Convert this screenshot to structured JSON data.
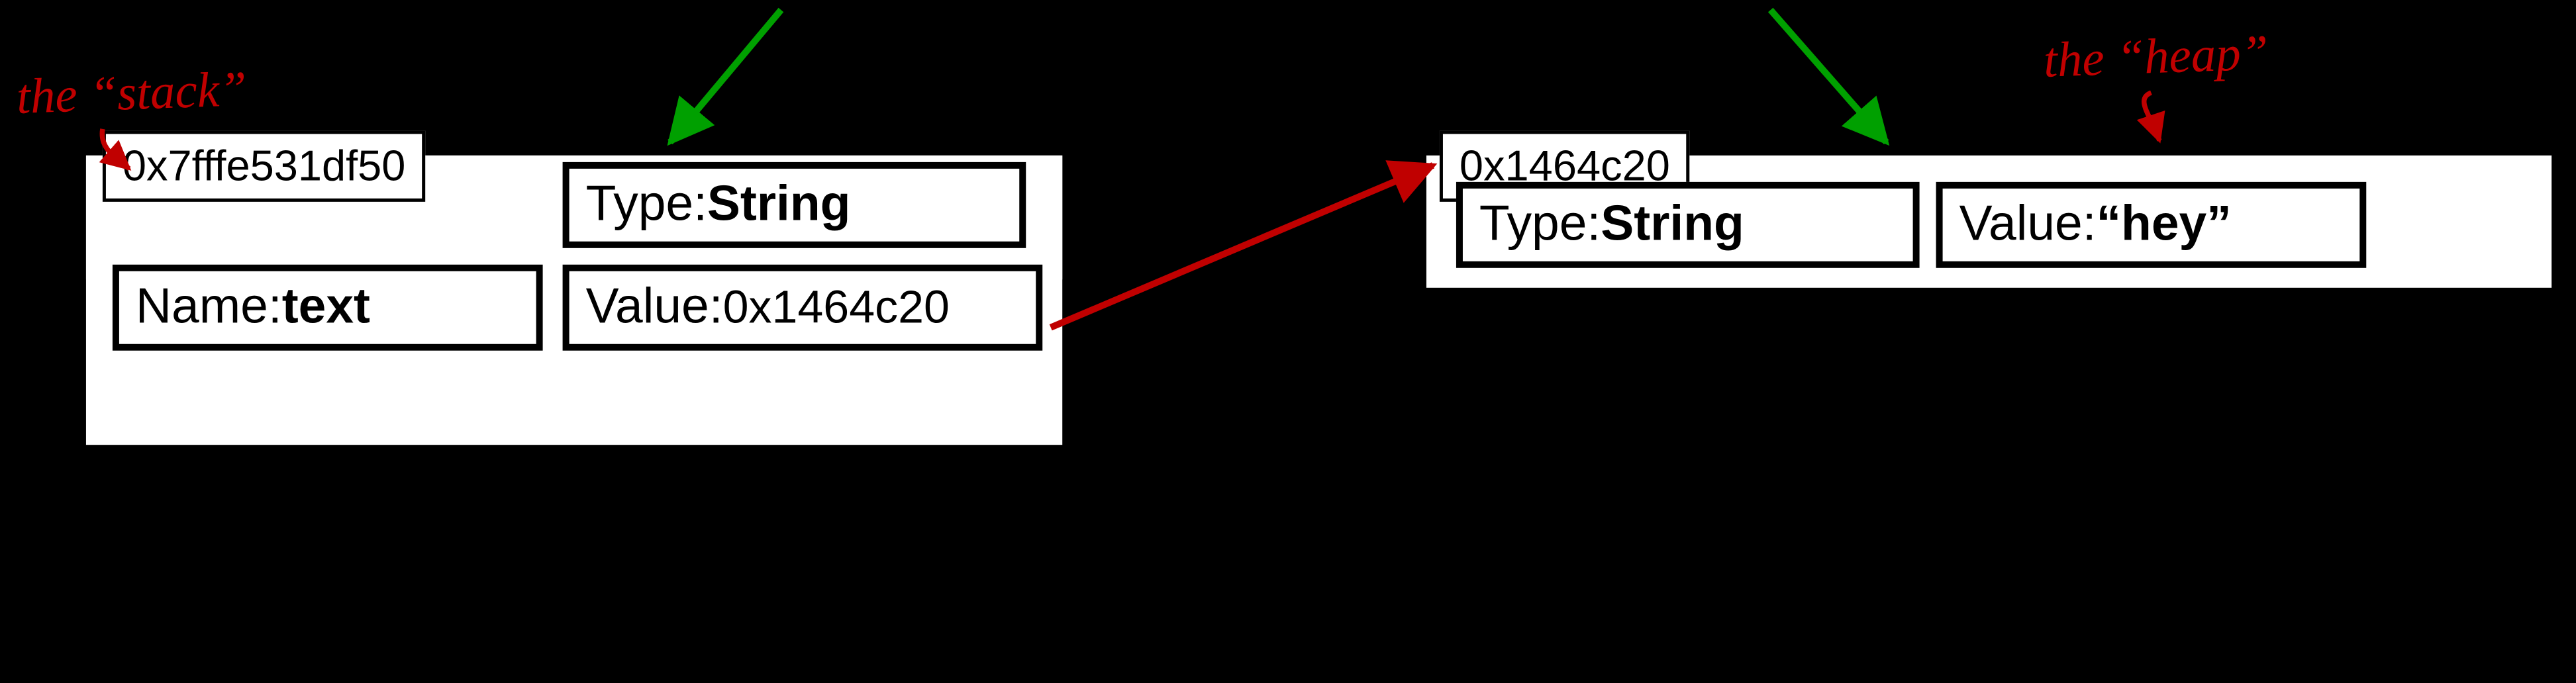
{
  "annotations": {
    "stack_label": "the “stack”",
    "heap_label": "the “heap”"
  },
  "stack": {
    "address": "0x7fffe531df50",
    "type_label": "Type: ",
    "type_value": "String",
    "name_label": "Name: ",
    "name_value": "text",
    "value_label": "Value: ",
    "value_value": "0x1464c20"
  },
  "heap": {
    "address": "0x1464c20",
    "type_label": "Type: ",
    "type_value": "String",
    "value_label": "Value: ",
    "value_value": "“hey”"
  }
}
